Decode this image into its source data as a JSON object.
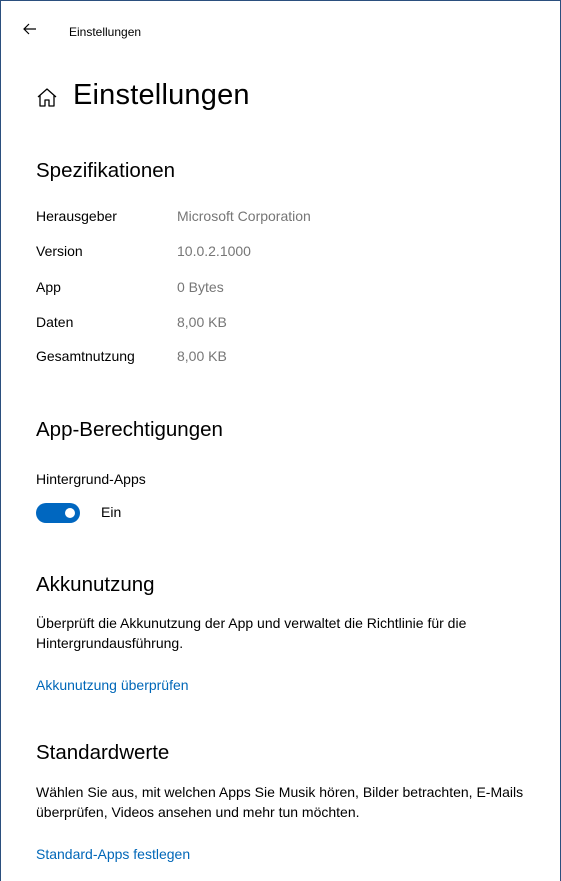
{
  "titlebar": {
    "back_icon": "back-arrow-icon",
    "title": "Einstellungen"
  },
  "header": {
    "home_icon": "home-icon",
    "title": "Einstellungen"
  },
  "specs": {
    "title": "Spezifikationen",
    "rows": [
      {
        "label": "Herausgeber",
        "value": "Microsoft Corporation"
      },
      {
        "label": "Version",
        "value": "10.0.2.1000"
      },
      {
        "label": "App",
        "value": "0 Bytes"
      },
      {
        "label": "Daten",
        "value": "8,00 KB"
      },
      {
        "label": "Gesamtnutzung",
        "value": "8,00 KB"
      }
    ]
  },
  "permissions": {
    "title": "App-Berechtigungen",
    "label": "Hintergrund-Apps",
    "toggle_state": "Ein",
    "toggle_on": true
  },
  "battery": {
    "title": "Akkunutzung",
    "description": "Überprüft die Akkunutzung der App und verwaltet die Richtlinie für die Hintergrundausführung.",
    "link": "Akkunutzung überprüfen"
  },
  "defaults": {
    "title": "Standardwerte",
    "description": "Wählen Sie aus, mit welchen Apps Sie Musik hören, Bilder betrachten, E-Mails überprüfen, Videos ansehen und mehr tun möchten.",
    "link": "Standard-Apps festlegen"
  },
  "colors": {
    "accent": "#0067c0",
    "link": "#0067b8",
    "secondary_text": "#767676",
    "window_border": "#2b4f7e"
  }
}
